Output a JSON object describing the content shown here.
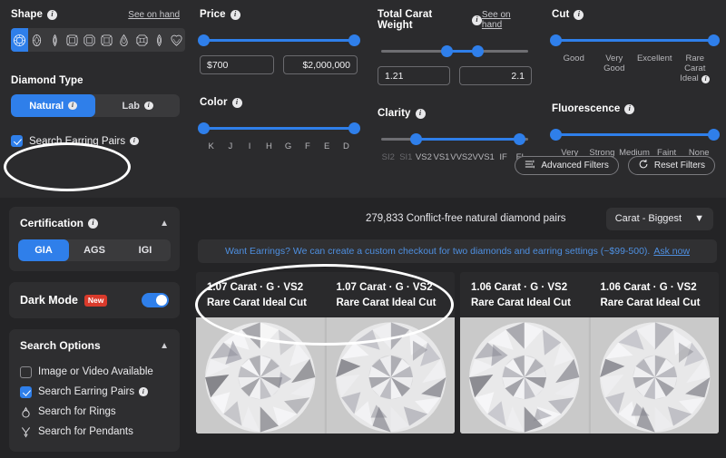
{
  "filters": {
    "shape": {
      "label": "Shape",
      "see_on_hand": "See on hand",
      "shapes": [
        "round",
        "oval",
        "marquise-narrow",
        "cushion",
        "emerald",
        "radiant",
        "pear",
        "asscher",
        "marquise",
        "heart"
      ],
      "selected": "round"
    },
    "price": {
      "label": "Price",
      "min_value": "$700",
      "max_value": "$2,000,000",
      "min_pct": 0,
      "max_pct": 100
    },
    "total_carat_weight": {
      "label": "Total Carat Weight",
      "see_on_hand": "See on hand",
      "min_value": "1.21",
      "max_value": "2.1",
      "min_pct": 45,
      "max_pct": 66
    },
    "cut": {
      "label": "Cut",
      "ticks": [
        "Good",
        "Very Good",
        "Excellent",
        "Rare Carat Ideal"
      ],
      "min_pct": 0,
      "max_pct": 100
    },
    "diamond_type": {
      "label": "Diamond Type",
      "options": [
        "Natural",
        "Lab"
      ],
      "selected": "Natural"
    },
    "color": {
      "label": "Color",
      "ticks": [
        "K",
        "J",
        "I",
        "H",
        "G",
        "F",
        "E",
        "D"
      ],
      "min_pct": 0,
      "max_pct": 100
    },
    "clarity": {
      "label": "Clarity",
      "ticks": [
        "SI2",
        "SI1",
        "VS2",
        "VS1",
        "VVS2",
        "VVS1",
        "IF",
        "FL"
      ],
      "dim_ticks": [
        "SI2",
        "SI1"
      ],
      "min_pct": 24,
      "max_pct": 94
    },
    "fluorescence": {
      "label": "Fluorescence",
      "ticks": [
        "Very Strong",
        "Strong",
        "Medium",
        "Faint",
        "None"
      ],
      "min_pct": 0,
      "max_pct": 100
    },
    "search_earring_pairs": {
      "label": "Search Earring Pairs",
      "checked": true
    },
    "advanced_filters_label": "Advanced Filters",
    "reset_filters_label": "Reset Filters"
  },
  "sidebar": {
    "certification": {
      "title": "Certification",
      "options": [
        "GIA",
        "AGS",
        "IGI"
      ],
      "selected": "GIA"
    },
    "dark_mode": {
      "title": "Dark Mode",
      "badge": "New",
      "enabled": true
    },
    "search_options": {
      "title": "Search Options",
      "items": [
        {
          "label": "Image or Video Available",
          "type": "checkbox",
          "checked": false,
          "info": false
        },
        {
          "label": "Search Earring Pairs",
          "type": "checkbox",
          "checked": true,
          "info": true
        },
        {
          "label": "Search for Rings",
          "type": "ring-icon",
          "checked": false,
          "info": false
        },
        {
          "label": "Search for Pendants",
          "type": "pendant-icon",
          "checked": false,
          "info": false
        }
      ]
    }
  },
  "results": {
    "count_text": "279,833 Conflict-free natural diamond pairs",
    "sort_label": "Carat - Biggest",
    "banner_text": "Want Earrings? We can create a custom checkout for two diamonds and earring settings (~$99-500).",
    "banner_link": "Ask now",
    "pairs": [
      {
        "left": {
          "line1": "1.07 Carat · G · VS2",
          "line2": "Rare Carat Ideal Cut"
        },
        "right": {
          "line1": "1.07 Carat · G · VS2",
          "line2": "Rare Carat Ideal Cut"
        }
      },
      {
        "left": {
          "line1": "1.06 Carat · G · VS2",
          "line2": "Rare Carat Ideal Cut"
        },
        "right": {
          "line1": "1.06 Carat · G · VS2",
          "line2": "Rare Carat Ideal Cut"
        }
      }
    ]
  },
  "colors": {
    "accent": "#2f7fea",
    "badge_red": "#d93a2b",
    "panel": "#2b2b2d",
    "background": "#242426",
    "annotation": "#ffffff"
  }
}
